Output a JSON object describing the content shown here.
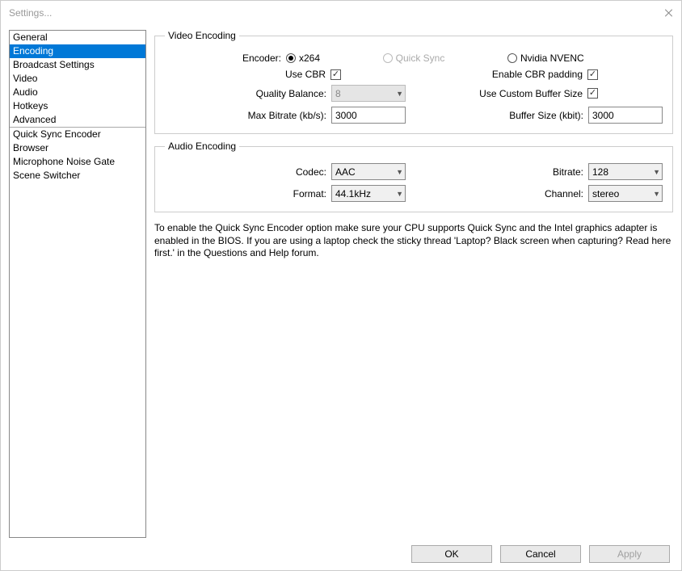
{
  "title": "Settings...",
  "sidebar": {
    "items": [
      {
        "label": "General"
      },
      {
        "label": "Encoding",
        "selected": true
      },
      {
        "label": "Broadcast Settings"
      },
      {
        "label": "Video"
      },
      {
        "label": "Audio"
      },
      {
        "label": "Hotkeys"
      },
      {
        "label": "Advanced"
      },
      {
        "label": "Quick Sync Encoder",
        "separatorBefore": true
      },
      {
        "label": "Browser"
      },
      {
        "label": "Microphone Noise Gate"
      },
      {
        "label": "Scene Switcher"
      }
    ]
  },
  "video": {
    "legend": "Video Encoding",
    "encoder_label": "Encoder:",
    "encoders": {
      "x264": "x264",
      "quicksync": "Quick Sync",
      "nvenc": "Nvidia NVENC"
    },
    "use_cbr_label": "Use CBR",
    "enable_cbr_padding_label": "Enable CBR padding",
    "quality_balance_label": "Quality Balance:",
    "quality_balance_value": "8",
    "use_custom_buffer_label": "Use Custom Buffer Size",
    "max_bitrate_label": "Max Bitrate (kb/s):",
    "max_bitrate_value": "3000",
    "buffer_size_label": "Buffer Size (kbit):",
    "buffer_size_value": "3000"
  },
  "audio": {
    "legend": "Audio Encoding",
    "codec_label": "Codec:",
    "codec_value": "AAC",
    "bitrate_label": "Bitrate:",
    "bitrate_value": "128",
    "format_label": "Format:",
    "format_value": "44.1kHz",
    "channel_label": "Channel:",
    "channel_value": "stereo"
  },
  "note": "To enable the Quick Sync Encoder option make sure your CPU supports Quick Sync and the Intel graphics adapter is enabled in the BIOS. If you are using a laptop check the sticky thread 'Laptop? Black screen when capturing? Read here first.' in the Questions and Help forum.",
  "buttons": {
    "ok": "OK",
    "cancel": "Cancel",
    "apply": "Apply"
  }
}
